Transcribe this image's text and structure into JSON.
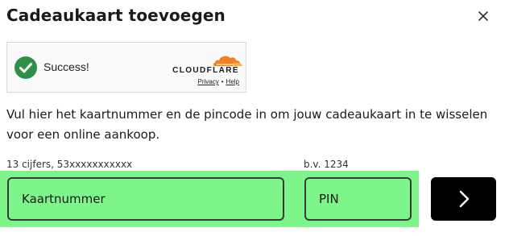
{
  "dialog": {
    "title": "Cadeaukaart toevoegen",
    "close_icon": "close-icon"
  },
  "captcha": {
    "status": "Success!",
    "brand": "CLOUDFLARE",
    "privacy_link": "Privacy",
    "separator": "•",
    "help_link": "Help",
    "check_color": "#2f8f46",
    "brand_color": "#f48120"
  },
  "description": "Vul hier het kaartnummer en de pincode in om jouw cadeaukaart in te wisselen voor een online aankoop.",
  "form": {
    "card_hint": "13 cijfers, 53xxxxxxxxxxx",
    "card_placeholder": "Kaartnummer",
    "pin_hint": "b.v. 1234",
    "pin_placeholder": "PIN",
    "submit_icon": "chevron-right-icon",
    "highlight_color": "#7ef58a"
  }
}
